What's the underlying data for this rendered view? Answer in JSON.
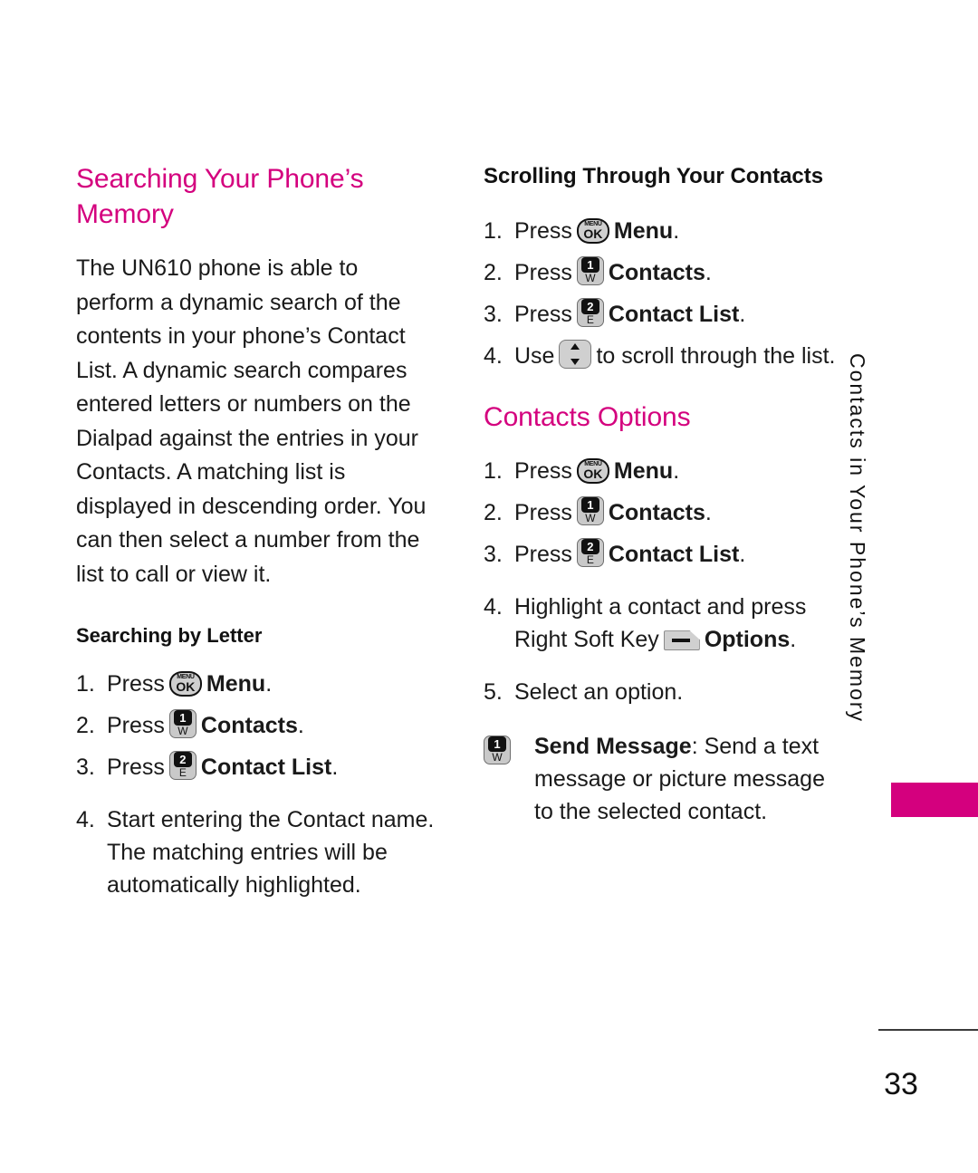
{
  "document": {
    "page_number": "33",
    "side_tab_label": "Contacts in Your Phone’s Memory",
    "accent_color": "#D4007E"
  },
  "left_column": {
    "heading": "Searching Your Phone’s Memory",
    "paragraph": "The UN610 phone is able to perform a dynamic search of the contents in your phone’s Contact List. A dynamic search compares entered letters or numbers on the Dialpad against the entries in your Contacts. A matching list is displayed in descending order. You can then select a number from the list to call or view it.",
    "subheading": "Searching by Letter",
    "steps": [
      {
        "num": "1.",
        "pre": "Press",
        "key": "menu-ok-key",
        "key_menu_label": "MENU",
        "key_ok_label": "OK",
        "bold_text": "Menu",
        "post": "."
      },
      {
        "num": "2.",
        "pre": "Press",
        "key": "keypad-1-w-key",
        "key_digit": "1",
        "key_letter": "W",
        "bold_text": "Contacts",
        "post": "."
      },
      {
        "num": "3.",
        "pre": "Press",
        "key": "keypad-2-e-key",
        "key_digit": "2",
        "key_letter": "E",
        "bold_text": "Contact List",
        "post": "."
      },
      {
        "num": "4.",
        "text": "Start entering the Contact name. The matching entries will be automatically highlighted."
      }
    ]
  },
  "right_column": {
    "heading": "Scrolling Through Your Contacts",
    "scroll_steps": [
      {
        "num": "1.",
        "pre": "Press",
        "key": "menu-ok-key",
        "key_menu_label": "MENU",
        "key_ok_label": "OK",
        "bold_text": "Menu",
        "post": "."
      },
      {
        "num": "2.",
        "pre": "Press",
        "key": "keypad-1-w-key",
        "key_digit": "1",
        "key_letter": "W",
        "bold_text": "Contacts",
        "post": "."
      },
      {
        "num": "3.",
        "pre": "Press",
        "key": "keypad-2-e-key",
        "key_digit": "2",
        "key_letter": "E",
        "bold_text": "Contact List",
        "post": "."
      },
      {
        "num": "4.",
        "pre": "Use",
        "key": "scroll-key",
        "post": "to scroll through the list."
      }
    ],
    "options_heading": "Contacts Options",
    "options_steps": [
      {
        "num": "1.",
        "pre": "Press",
        "key": "menu-ok-key",
        "key_menu_label": "MENU",
        "key_ok_label": "OK",
        "bold_text": "Menu",
        "post": "."
      },
      {
        "num": "2.",
        "pre": "Press",
        "key": "keypad-1-w-key",
        "key_digit": "1",
        "key_letter": "W",
        "bold_text": "Contacts",
        "post": "."
      },
      {
        "num": "3.",
        "pre": "Press",
        "key": "keypad-2-e-key",
        "key_digit": "2",
        "key_letter": "E",
        "bold_text": "Contact List",
        "post": "."
      },
      {
        "num": "4.",
        "line1": "Highlight a contact and press",
        "line2_pre": "Right Soft Key",
        "key": "right-soft-key",
        "bold_text": "Options",
        "post": "."
      },
      {
        "num": "5.",
        "text": "Select an option."
      }
    ],
    "option_item": {
      "key_digit": "1",
      "key_letter": "W",
      "term": "Send Message",
      "separator": ":",
      "description": " Send a text message or picture message to the selected contact."
    }
  }
}
